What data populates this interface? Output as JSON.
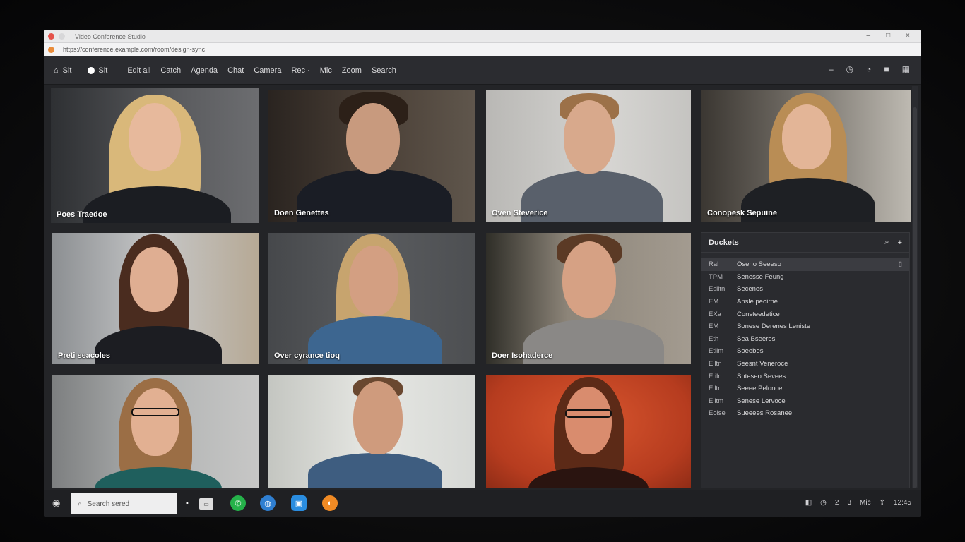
{
  "browser": {
    "tab_title": "Video Conference Studio",
    "address": "https://conference.example.com/room/design-sync",
    "window_controls": [
      "–",
      "□",
      "×"
    ],
    "nav_controls": [
      "↻",
      "⋮"
    ]
  },
  "toolbar": {
    "items": [
      {
        "label": "Sit",
        "icon": "home-icon"
      },
      {
        "label": "Sit",
        "icon": "circle-icon"
      },
      {
        "label": "Edit all"
      },
      {
        "label": "Catch"
      },
      {
        "label": "Agenda"
      },
      {
        "label": "Chat"
      },
      {
        "label": "Camera"
      },
      {
        "label": "Rec ·"
      },
      {
        "label": "Mic"
      },
      {
        "label": "Zoom"
      },
      {
        "label": "Search"
      }
    ],
    "right_icons": [
      "minimize-icon",
      "clock-icon",
      "settings-icon",
      "stop-icon",
      "layout-icon"
    ]
  },
  "participants": [
    {
      "name": "Poes Traedoe",
      "active": true
    },
    {
      "name": "Doen Genettes"
    },
    {
      "name": "Oven Steverice"
    },
    {
      "name": "Conopesk Sepuine"
    },
    {
      "name": "Preti seacoles"
    },
    {
      "name": "Over cyrance tioq"
    },
    {
      "name": "Doer Isohaderce"
    },
    {
      "name": ""
    },
    {
      "name": ""
    },
    {
      "name": ""
    }
  ],
  "panel": {
    "title": "Duckets",
    "search_icon": "search-icon",
    "add_icon": "plus-icon",
    "rows": [
      {
        "status": "Ral",
        "name": "Oseno Seeeso",
        "selected": true
      },
      {
        "status": "TPM",
        "name": "Senesse Feung"
      },
      {
        "status": "Esiltn",
        "name": "Secenes"
      },
      {
        "status": "EM",
        "name": "Ansle peoirne"
      },
      {
        "status": "EXa",
        "name": "Consteedetice"
      },
      {
        "status": "EM",
        "name": "Sonese Derenes Leniste"
      },
      {
        "status": "Eth",
        "name": "Sea Bseeres"
      },
      {
        "status": "Etilm",
        "name": "Soeebes"
      },
      {
        "status": "Eiltn",
        "name": "Seesnt Veneroce"
      },
      {
        "status": "Etiln",
        "name": "Snteseo Sevees"
      },
      {
        "status": "Eiltn",
        "name": "Seeee Pelonce"
      },
      {
        "status": "Eiltm",
        "name": "Senese Lervoce"
      },
      {
        "status": "Eolse",
        "name": "Sueeees Rosanee"
      }
    ]
  },
  "taskbar": {
    "search_placeholder": "Search sered",
    "apps": [
      "chat-icon",
      "window-icon",
      "whatsapp-icon",
      "globe-icon",
      "app-icon",
      "firefox-icon"
    ],
    "tray": [
      "◧",
      "◷",
      "2",
      "3",
      "Mic",
      "⇪"
    ],
    "clock": "12:45"
  },
  "colors": {
    "accent": "#e0482f",
    "toolbar_bg": "#2b2c30",
    "panel_bg": "#2a2b2f"
  }
}
